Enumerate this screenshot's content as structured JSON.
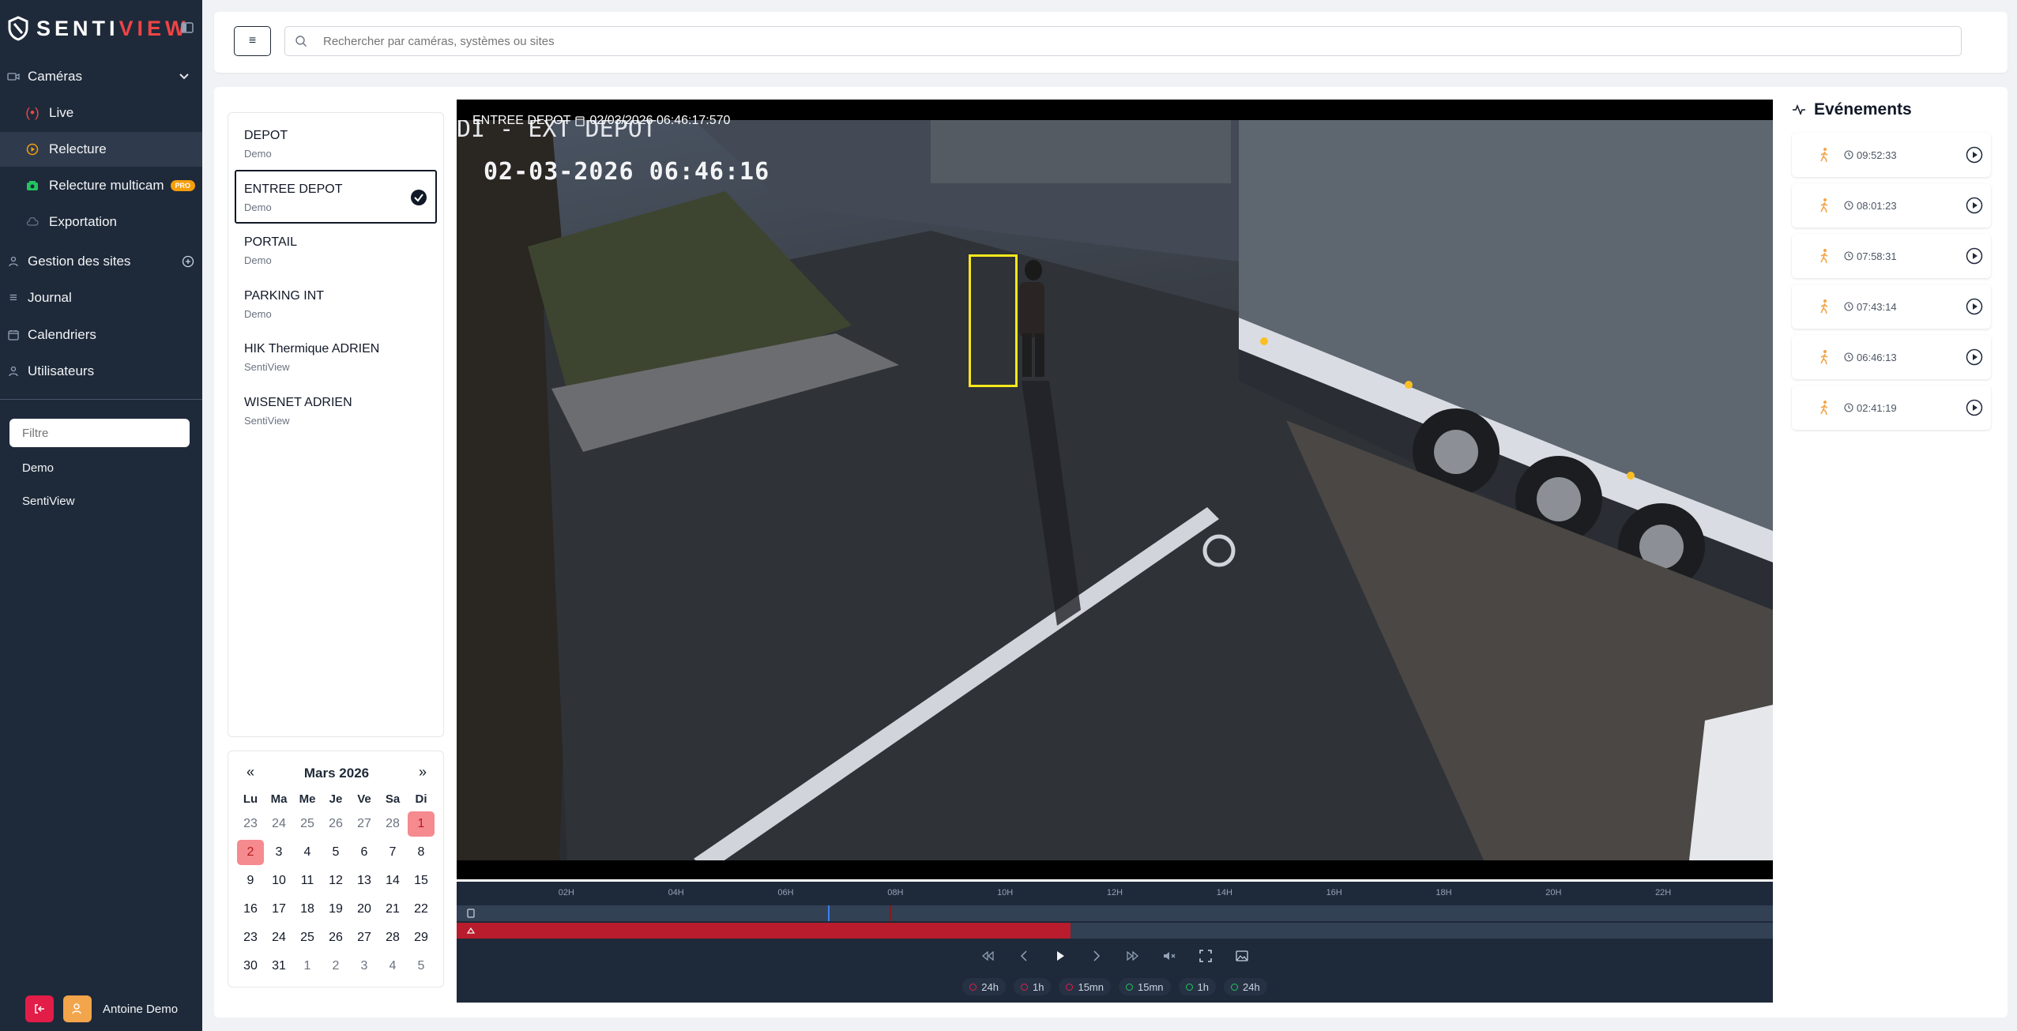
{
  "app": {
    "brand_a": "SENTI",
    "brand_b": "VIEW"
  },
  "sidebar": {
    "cameras_label": "Caméras",
    "live_label": "Live",
    "replay_label": "Relecture",
    "multicam_label": "Relecture multicam",
    "pro_badge": "PRO",
    "export_label": "Exportation",
    "sites_label": "Gestion des sites",
    "journal_label": "Journal",
    "calendars_label": "Calendriers",
    "users_label": "Utilisateurs",
    "filter_placeholder": "Filtre",
    "sites": [
      "Demo",
      "SentiView"
    ],
    "user_name": "Antoine Demo"
  },
  "header": {
    "menu_glyph": "≡",
    "search_placeholder": "Rechercher par caméras, systèmes ou sites"
  },
  "cameras": [
    {
      "name": "DEPOT",
      "site": "Demo",
      "selected": false
    },
    {
      "name": "ENTREE DEPOT",
      "site": "Demo",
      "selected": true
    },
    {
      "name": "PORTAIL",
      "site": "Demo",
      "selected": false
    },
    {
      "name": "PARKING INT",
      "site": "Demo",
      "selected": false
    },
    {
      "name": "HIK Thermique ADRIEN",
      "site": "SentiView",
      "selected": false
    },
    {
      "name": "WISENET ADRIEN",
      "site": "SentiView",
      "selected": false
    }
  ],
  "calendar": {
    "prev": "«",
    "next": "»",
    "title": "Mars 2026",
    "weekdays": [
      "Lu",
      "Ma",
      "Me",
      "Je",
      "Ve",
      "Sa",
      "Di"
    ],
    "days": [
      {
        "d": "23",
        "other": true
      },
      {
        "d": "24",
        "other": true
      },
      {
        "d": "25",
        "other": true
      },
      {
        "d": "26",
        "other": true
      },
      {
        "d": "27",
        "other": true
      },
      {
        "d": "28",
        "other": true
      },
      {
        "d": "1",
        "marked": true
      },
      {
        "d": "2",
        "marked": true
      },
      {
        "d": "3"
      },
      {
        "d": "4"
      },
      {
        "d": "5"
      },
      {
        "d": "6"
      },
      {
        "d": "7"
      },
      {
        "d": "8"
      },
      {
        "d": "9"
      },
      {
        "d": "10"
      },
      {
        "d": "11"
      },
      {
        "d": "12"
      },
      {
        "d": "13"
      },
      {
        "d": "14"
      },
      {
        "d": "15"
      },
      {
        "d": "16"
      },
      {
        "d": "17"
      },
      {
        "d": "18"
      },
      {
        "d": "19"
      },
      {
        "d": "20"
      },
      {
        "d": "21"
      },
      {
        "d": "22"
      },
      {
        "d": "23"
      },
      {
        "d": "24"
      },
      {
        "d": "25"
      },
      {
        "d": "26"
      },
      {
        "d": "27"
      },
      {
        "d": "28"
      },
      {
        "d": "29"
      },
      {
        "d": "30"
      },
      {
        "d": "31"
      },
      {
        "d": "1",
        "other": true
      },
      {
        "d": "2",
        "other": true
      },
      {
        "d": "3",
        "other": true
      },
      {
        "d": "4",
        "other": true
      },
      {
        "d": "5",
        "other": true
      }
    ]
  },
  "video": {
    "camera": "ENTREE DEPOT",
    "timestamp": "02/03/2026 06:46:17:570",
    "osd_title": "DI - EXT DEPOT",
    "osd_time": "02-03-2026 06:46:16"
  },
  "timeline": {
    "hours": [
      "02H",
      "04H",
      "06H",
      "08H",
      "10H",
      "12H",
      "14H",
      "16H",
      "18H",
      "20H",
      "22H"
    ],
    "recorded_until_hour": 11.2,
    "cursor_hour": 6.77,
    "event_marker_hour": 7.9,
    "jumps": [
      {
        "label": "24h",
        "dir": "back"
      },
      {
        "label": "1h",
        "dir": "back"
      },
      {
        "label": "15mn",
        "dir": "back"
      },
      {
        "label": "15mn",
        "dir": "fwd"
      },
      {
        "label": "1h",
        "dir": "fwd"
      },
      {
        "label": "24h",
        "dir": "fwd"
      }
    ]
  },
  "events": {
    "title": "Evénements",
    "items": [
      "09:52:33",
      "08:01:23",
      "07:58:31",
      "07:43:14",
      "06:46:13",
      "02:41:19"
    ]
  },
  "colors": {
    "accent_red": "#ef4444",
    "sidebar_bg": "#1e2a3a",
    "detection_box": "#f8e81c",
    "event_person": "#f2a54a"
  }
}
